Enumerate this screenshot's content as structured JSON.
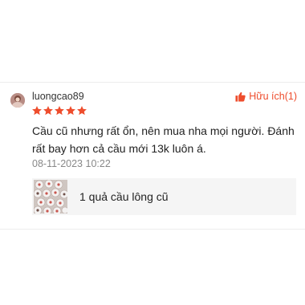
{
  "review": {
    "username": "luongcao89",
    "rating": 5,
    "rating_max": 5,
    "helpful_label": "Hữu ích(1)",
    "text": "Cầu cũ nhưng rất ổn, nên mua nha mọi người. Đánh rất bay hơn cả cầu mới 13k luôn á.",
    "date": "08-11-2023 10:22",
    "product": {
      "name": "1 quả cầu lông cũ"
    }
  },
  "icons": {
    "helpful": "thumbs-up-icon",
    "star": "star-icon"
  },
  "colors": {
    "accent": "#ee4d2d",
    "star": "#ee4d2d",
    "text": "#222222",
    "muted": "#888888",
    "card_bg": "#f5f5f5"
  }
}
